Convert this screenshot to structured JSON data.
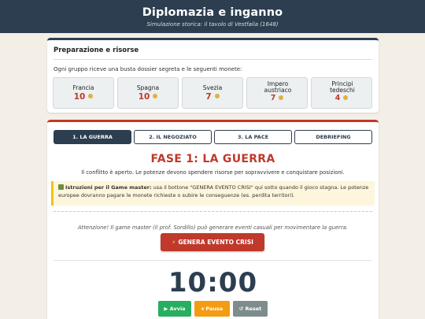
{
  "header": {
    "title": "Diplomazia e inganno",
    "subtitle": "Simulazione storica: il tavolo di Vestfalia (1648)"
  },
  "resources": {
    "title": "Preparazione e risorse",
    "intro": "Ogni gruppo riceve una busta dossier segreta e le seguenti monete:",
    "groups": [
      {
        "name": "Francia",
        "coins": "10"
      },
      {
        "name": "Spagna",
        "coins": "10"
      },
      {
        "name": "Svezia",
        "coins": "7"
      },
      {
        "name": "Impero austriaco",
        "coins": "7"
      },
      {
        "name": "Principi tedeschi",
        "coins": "4"
      }
    ]
  },
  "tabs": [
    {
      "label": "1. LA GUERRA",
      "active": true
    },
    {
      "label": "2. IL NEGOZIATO",
      "active": false
    },
    {
      "label": "3. LA PACE",
      "active": false
    },
    {
      "label": "DEBRIEFING",
      "active": false
    }
  ],
  "phase": {
    "title": "FASE 1: LA GUERRA",
    "description": "Il conflitto è aperto. Le potenze devono spendere risorse per sopravvivere e conquistare posizioni.",
    "gm_label": "Istruzioni per il Game master:",
    "gm_text": " usa il bottone \"GENERA EVENTO CRISI\" qui sotto quando il gioco stagna. Le potenze europee dovranno pagare le monete richieste o subire le conseguenze (es. perdita territori).",
    "warning": "Attenzione! Il game master (il prof. Sordillo) può generare eventi casuali per movimentare la guerra.",
    "crisis_button": "GENERA EVENTO CRISI"
  },
  "timer": {
    "display": "10:00",
    "start_label": "▶ Avvia",
    "pause_label": "⏸ Pausa",
    "reset_label": "↺ Reset"
  },
  "colors": {
    "navy": "#2c3e50",
    "red": "#c0392b",
    "green": "#27ae60",
    "orange": "#f39c12",
    "gray": "#7f8c8d",
    "coin": "#e0b040"
  }
}
